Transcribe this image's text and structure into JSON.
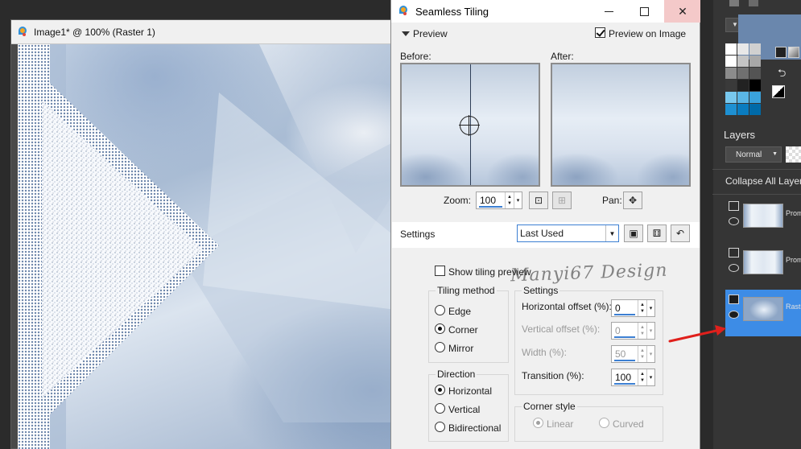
{
  "image_window": {
    "title": "Image1* @ 100% (Raster 1)"
  },
  "dialog": {
    "title": "Seamless Tiling",
    "preview_section_label": "Preview",
    "preview_on_image_label": "Preview on Image",
    "preview_on_image_checked": true,
    "before_label": "Before:",
    "after_label": "After:",
    "zoom_label": "Zoom:",
    "zoom_value": "100",
    "pan_label": "Pan:",
    "settings_label": "Settings",
    "preset_value": "Last Used",
    "show_tiling_preview_label": "Show tiling preview",
    "show_tiling_preview_checked": false,
    "tiling_method": {
      "title": "Tiling method",
      "options": [
        "Edge",
        "Corner",
        "Mirror"
      ],
      "selected": "Corner"
    },
    "direction": {
      "title": "Direction",
      "options": [
        "Horizontal",
        "Vertical",
        "Bidirectional"
      ],
      "selected": "Horizontal"
    },
    "settings_group": {
      "title": "Settings",
      "horizontal_offset_label": "Horizontal offset (%):",
      "horizontal_offset_value": "0",
      "vertical_offset_label": "Vertical offset (%):",
      "vertical_offset_value": "0",
      "width_label": "Width (%):",
      "width_value": "50",
      "transition_label": "Transition (%):",
      "transition_value": "100"
    },
    "corner_style": {
      "title": "Corner style",
      "options": [
        "Linear",
        "Curved"
      ],
      "selected": "Linear"
    },
    "watermark": "Manyi67 Design"
  },
  "layers_panel": {
    "title": "Layers",
    "blend_mode": "Normal",
    "collapse_label": "Collapse All Layers",
    "layers": [
      {
        "name": "Prom",
        "selected": false
      },
      {
        "name": "Prom",
        "selected": false
      },
      {
        "name": "Raste",
        "selected": true
      }
    ]
  },
  "colors": {
    "foreground_swatch": "#6a87ad",
    "selected_layer_bg": "#3d8ce6",
    "annotation_arrow": "#e0201c",
    "palette": [
      "#ffffff",
      "#e8e8e8",
      "#d0d0d0",
      "#ffffff",
      "#c4c4c4",
      "#a8a8a8",
      "#8c8c8c",
      "#707070",
      "#545454",
      "#3a3a3a",
      "#222222",
      "#000000",
      "#78c8ee",
      "#5ab6e6",
      "#3aa2dc",
      "#1e90d2",
      "#0a7cc0",
      "#006aa8"
    ]
  }
}
